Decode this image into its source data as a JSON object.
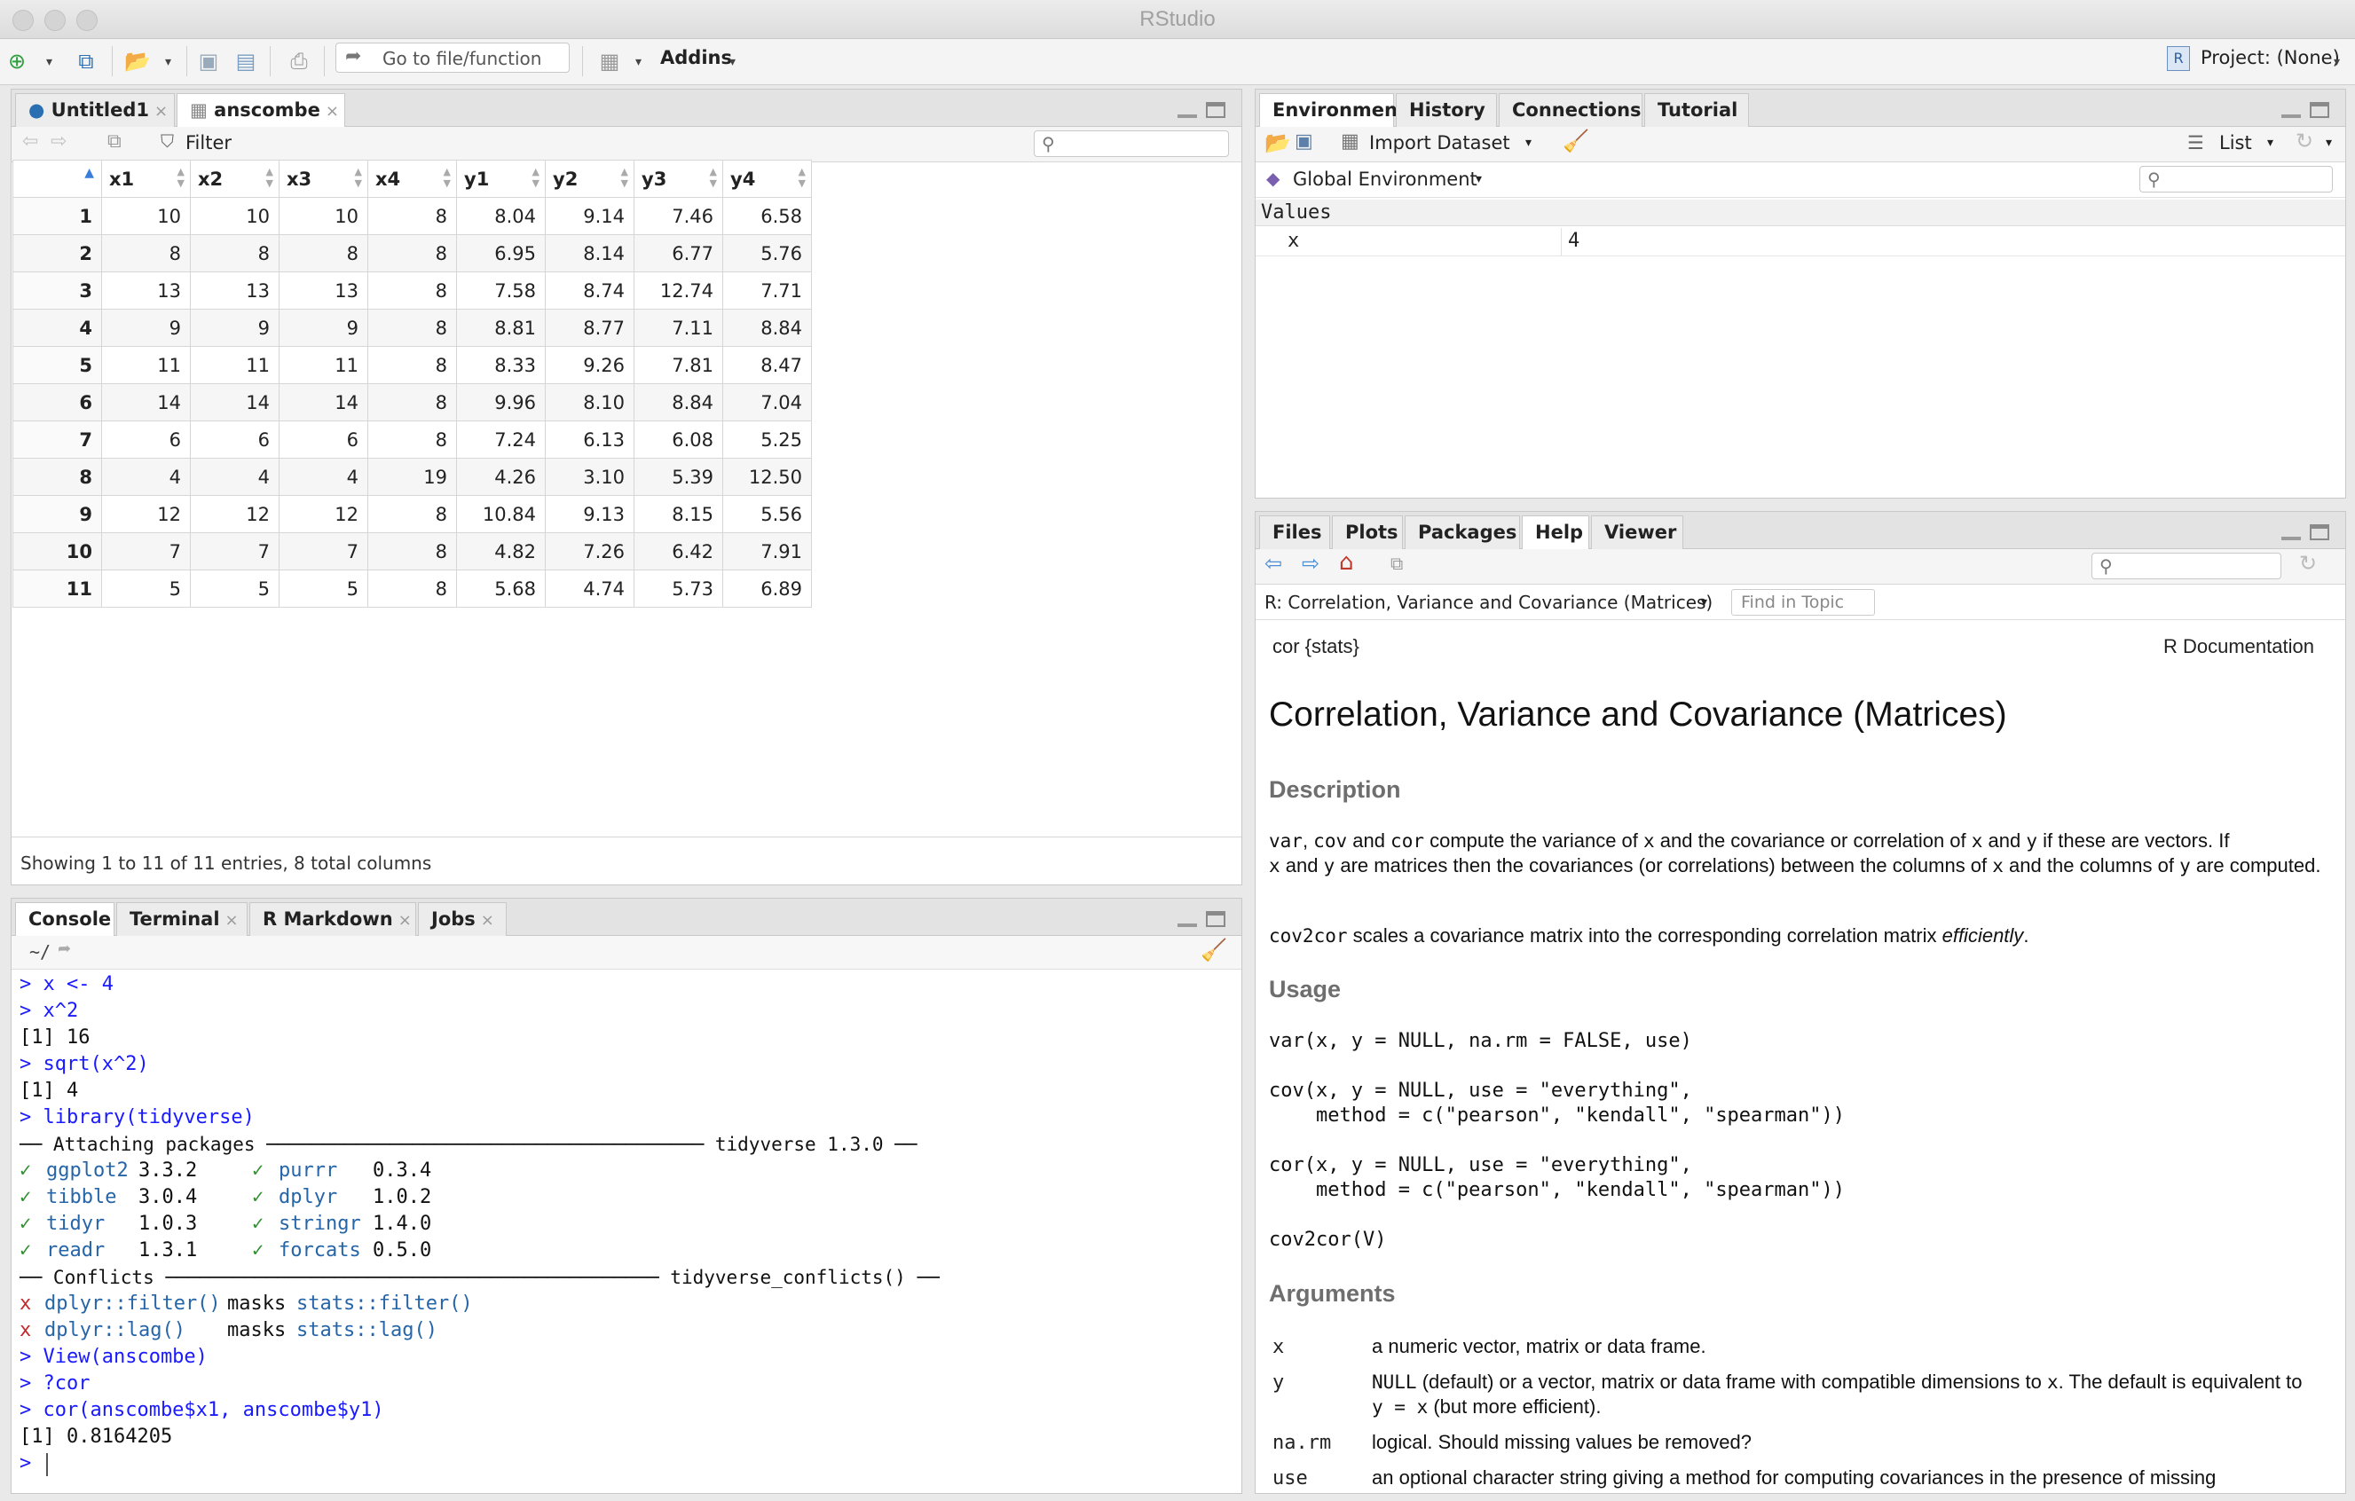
{
  "app": {
    "title": "RStudio",
    "project_label": "Project: (None)"
  },
  "toolbar": {
    "goto_label": "Go to file/function",
    "addins_label": "Addins"
  },
  "source": {
    "tabs": [
      {
        "label": "Untitled1"
      },
      {
        "label": "anscombe"
      }
    ],
    "filter_label": "Filter",
    "columns": [
      "x1",
      "x2",
      "x3",
      "x4",
      "y1",
      "y2",
      "y3",
      "y4"
    ],
    "rows": [
      [
        "1",
        "10",
        "10",
        "10",
        "8",
        "8.04",
        "9.14",
        "7.46",
        "6.58"
      ],
      [
        "2",
        "8",
        "8",
        "8",
        "8",
        "6.95",
        "8.14",
        "6.77",
        "5.76"
      ],
      [
        "3",
        "13",
        "13",
        "13",
        "8",
        "7.58",
        "8.74",
        "12.74",
        "7.71"
      ],
      [
        "4",
        "9",
        "9",
        "9",
        "8",
        "8.81",
        "8.77",
        "7.11",
        "8.84"
      ],
      [
        "5",
        "11",
        "11",
        "11",
        "8",
        "8.33",
        "9.26",
        "7.81",
        "8.47"
      ],
      [
        "6",
        "14",
        "14",
        "14",
        "8",
        "9.96",
        "8.10",
        "8.84",
        "7.04"
      ],
      [
        "7",
        "6",
        "6",
        "6",
        "8",
        "7.24",
        "6.13",
        "6.08",
        "5.25"
      ],
      [
        "8",
        "4",
        "4",
        "4",
        "19",
        "4.26",
        "3.10",
        "5.39",
        "12.50"
      ],
      [
        "9",
        "12",
        "12",
        "12",
        "8",
        "10.84",
        "9.13",
        "8.15",
        "5.56"
      ],
      [
        "10",
        "7",
        "7",
        "7",
        "8",
        "4.82",
        "7.26",
        "6.42",
        "7.91"
      ],
      [
        "11",
        "5",
        "5",
        "5",
        "8",
        "5.68",
        "4.74",
        "5.73",
        "6.89"
      ]
    ],
    "status": "Showing 1 to 11 of 11 entries, 8 total columns"
  },
  "console": {
    "tabs": [
      {
        "label": "Console"
      },
      {
        "label": "Terminal"
      },
      {
        "label": "R Markdown"
      },
      {
        "label": "Jobs"
      }
    ],
    "path": "~/",
    "lines": {
      "l1": "> x <- 4",
      "l2": "> x^2",
      "l3": "[1] 16",
      "l4": "> sqrt(x^2)",
      "l5": "[1] 4",
      "l6": "> library(tidyverse)",
      "l7": "── Attaching packages ─────────────────────────────────────── tidyverse 1.3.0 ──",
      "l16": "── Conflicts ──────────────────────────────────────────── tidyverse_conflicts() ──",
      "l19": "> View(anscombe)",
      "l20": "> ?cor",
      "l21": "> cor(anscombe$x1, anscombe$y1)",
      "l22": "[1] 0.8164205",
      "l23": ">"
    },
    "packages": [
      {
        "check": "✓",
        "name": "ggplot2",
        "ver": "3.3.2",
        "name2": "purrr",
        "ver2": "0.3.4"
      },
      {
        "check": "✓",
        "name": "tibble",
        "ver": "3.0.4",
        "name2": "dplyr",
        "ver2": "1.0.2"
      },
      {
        "check": "✓",
        "name": "tidyr",
        "ver": "1.0.3",
        "name2": "stringr",
        "ver2": "1.4.0"
      },
      {
        "check": "✓",
        "name": "readr",
        "ver": "1.3.1",
        "name2": "forcats",
        "ver2": "0.5.0"
      }
    ],
    "conflicts": [
      {
        "mark": "x",
        "fn": "dplyr::filter()",
        "masks": "masks",
        "base": "stats::filter()"
      },
      {
        "mark": "x",
        "fn": "dplyr::lag()",
        "masks": "masks",
        "base": "stats::lag()"
      }
    ]
  },
  "environment": {
    "tabs": [
      {
        "label": "Environment"
      },
      {
        "label": "History"
      },
      {
        "label": "Connections"
      },
      {
        "label": "Tutorial"
      }
    ],
    "import_label": "Import Dataset",
    "list_label": "List",
    "scope_label": "Global Environment",
    "section": "Values",
    "vars": [
      {
        "name": "x",
        "value": "4"
      }
    ]
  },
  "help": {
    "tabs": [
      {
        "label": "Files"
      },
      {
        "label": "Plots"
      },
      {
        "label": "Packages"
      },
      {
        "label": "Help"
      },
      {
        "label": "Viewer"
      }
    ],
    "topic_select": "R: Correlation, Variance and Covariance (Matrices)",
    "find_placeholder": "Find in Topic",
    "header_left": "cor {stats}",
    "header_right": "R Documentation",
    "title": "Correlation, Variance and Covariance (Matrices)",
    "sections": {
      "description": "Description",
      "usage": "Usage",
      "arguments": "Arguments"
    },
    "desc1": {
      "c1": "var",
      "t1": ", ",
      "c2": "cov",
      "t2": " and ",
      "c3": "cor",
      "t3": " compute the variance of ",
      "c4": "x",
      "t4": " and the covariance or correlation of ",
      "c5": "x",
      "t5": " and ",
      "c6": "y",
      "t6": " if these are vectors. If",
      "c7": "x",
      "t7": " and ",
      "c8": "y",
      "t8": " are matrices then the covariances (or correlations) between the columns of ",
      "c9": "x",
      "t9": " and the columns of ",
      "c10": "y",
      "t10": " are computed."
    },
    "desc2": {
      "c1": "cov2cor",
      "t1": " scales a covariance matrix into the corresponding correlation matrix ",
      "em": "efficiently",
      "t2": "."
    },
    "usage": [
      "var(x, y = NULL, na.rm = FALSE, use)",
      "cov(x, y = NULL, use = \"everything\",",
      "    method = c(\"pearson\", \"kendall\", \"spearman\"))",
      "cor(x, y = NULL, use = \"everything\",",
      "    method = c(\"pearson\", \"kendall\", \"spearman\"))",
      "cov2cor(V)"
    ],
    "args": [
      {
        "name": "x",
        "desc": "a numeric vector, matrix or data frame."
      },
      {
        "name": "y",
        "c1": "NULL",
        "t1": " (default) or a vector, matrix or data frame with compatible dimensions to ",
        "c2": "x",
        "t2": ". The default is equivalent to ",
        "c3": "y = x",
        "t3": " (but more efficient)."
      },
      {
        "name": "na.rm",
        "desc": "logical. Should missing values be removed?"
      },
      {
        "name": "use",
        "desc": "an optional character string giving a method for computing covariances in the presence of missing"
      }
    ]
  }
}
